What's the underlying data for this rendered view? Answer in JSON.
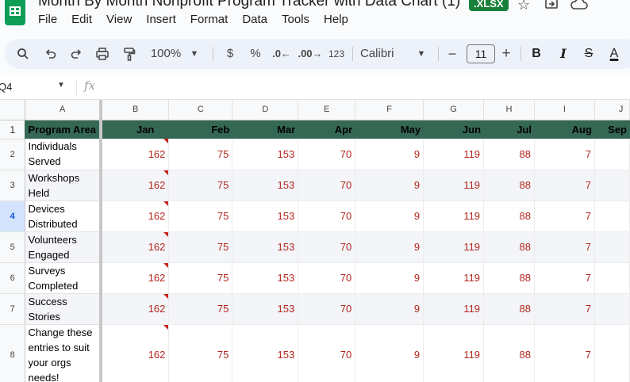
{
  "app": {
    "doc_title": "Month By Month Nonprofit Program Tracker with Data Chart (1)",
    "file_badge": ".XLSX",
    "star_icon": "star-icon",
    "move_icon": "move-to-folder-icon",
    "cloud_icon": "cloud-status-icon"
  },
  "menu": [
    "File",
    "Edit",
    "View",
    "Insert",
    "Format",
    "Data",
    "Tools",
    "Help"
  ],
  "toolbar": {
    "zoom": "100%",
    "currency": "$",
    "percent": "%",
    "decrease_decimal": ".0←",
    "increase_decimal": ".00→",
    "number_format": "123",
    "font_family": "Calibri",
    "font_size": "11",
    "bold": "B",
    "italic": "I",
    "strike": "S",
    "text_color": "A"
  },
  "formula_bar": {
    "cell_ref": "Q4",
    "fx": "fx",
    "value": ""
  },
  "sheet": {
    "column_letters": [
      "A",
      "B",
      "C",
      "D",
      "E",
      "F",
      "G",
      "H",
      "I",
      "J"
    ],
    "header_row_number": "1",
    "area_header": "Program Area",
    "months": [
      "Jan",
      "Feb",
      "Mar",
      "Apr",
      "May",
      "Jun",
      "Jul",
      "Aug",
      "Sep"
    ],
    "rows": [
      {
        "num": "2",
        "label": "Individuals Served",
        "values": [
          "162",
          "75",
          "153",
          "70",
          "9",
          "119",
          "88",
          "7"
        ]
      },
      {
        "num": "3",
        "label": "Workshops Held",
        "values": [
          "162",
          "75",
          "153",
          "70",
          "9",
          "119",
          "88",
          "7"
        ]
      },
      {
        "num": "4",
        "label": "Devices Distributed",
        "values": [
          "162",
          "75",
          "153",
          "70",
          "9",
          "119",
          "88",
          "7"
        ]
      },
      {
        "num": "5",
        "label": "Volunteers Engaged",
        "values": [
          "162",
          "75",
          "153",
          "70",
          "9",
          "119",
          "88",
          "7"
        ]
      },
      {
        "num": "6",
        "label": "Surveys Completed",
        "values": [
          "162",
          "75",
          "153",
          "70",
          "9",
          "119",
          "88",
          "7"
        ]
      },
      {
        "num": "7",
        "label": "Success Stories",
        "values": [
          "162",
          "75",
          "153",
          "70",
          "9",
          "119",
          "88",
          "7"
        ]
      },
      {
        "num": "8",
        "label": "Change these entries to suit your orgs needs!",
        "values": [
          "162",
          "75",
          "153",
          "70",
          "9",
          "119",
          "88",
          "7"
        ]
      }
    ],
    "selected_row": "4",
    "header_fill": "#356854",
    "value_color": "#b3261e"
  }
}
